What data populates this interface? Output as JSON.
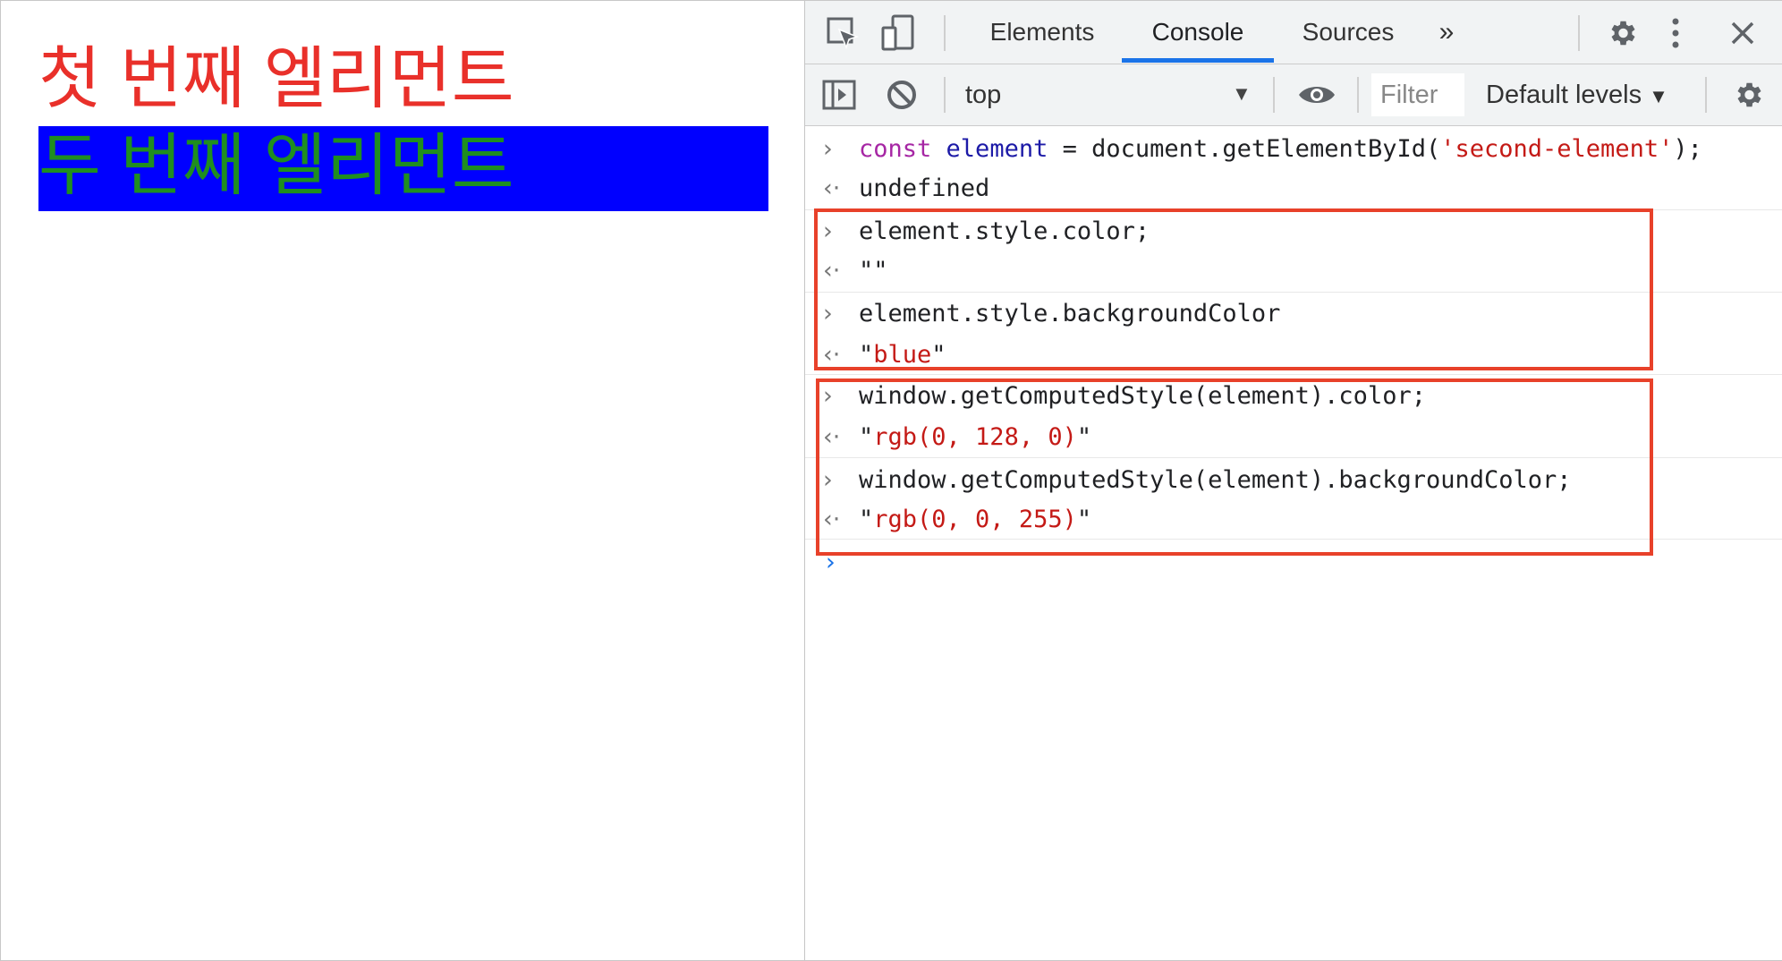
{
  "page": {
    "first_element_text": "첫 번째 엘리먼트",
    "second_element_text": "두 번째 엘리먼트",
    "colors": {
      "first_text": "#e9302a",
      "second_text": "#1f8e1f",
      "second_bg": "#0000ff"
    }
  },
  "devtools": {
    "tabs": [
      {
        "label": "Elements",
        "active": false
      },
      {
        "label": "Console",
        "active": true
      },
      {
        "label": "Sources",
        "active": false
      }
    ],
    "more_tabs_glyph": "»",
    "toolbar": {
      "context": "top",
      "filter_placeholder": "Filter",
      "levels": "Default levels"
    },
    "icons": [
      "inspect-icon",
      "device-toggle-icon",
      "more-tabs-icon",
      "settings-icon",
      "kebab-menu-icon",
      "close-icon",
      "sidebar-toggle-icon",
      "clear-console-icon",
      "context-dropdown-icon",
      "live-expression-eye-icon",
      "console-settings-icon"
    ],
    "accent_color": "#1a73e8",
    "highlight_color": "#e8412a"
  },
  "console": {
    "entries": [
      {
        "type": "input",
        "kw": "const",
        "var": "element",
        "mid": " = document.getElementById(",
        "str": "'second-element'",
        "end": ");"
      },
      {
        "type": "output",
        "text": "undefined"
      },
      {
        "type": "input",
        "text": "element.style.color;"
      },
      {
        "type": "output",
        "text": "\"\""
      },
      {
        "type": "input",
        "text": "element.style.backgroundColor"
      },
      {
        "type": "output",
        "q1": "\"",
        "value": "blue",
        "q2": "\""
      },
      {
        "type": "input",
        "text": "window.getComputedStyle(element).color;"
      },
      {
        "type": "output",
        "q1": "\"",
        "value": "rgb(0, 128, 0)",
        "q2": "\""
      },
      {
        "type": "input",
        "text": "window.getComputedStyle(element).backgroundColor;"
      },
      {
        "type": "output",
        "q1": "\"",
        "value": "rgb(0, 0, 255)",
        "q2": "\""
      }
    ],
    "prompt_in": "›",
    "prompt_out": "‹·",
    "caret": "›"
  }
}
